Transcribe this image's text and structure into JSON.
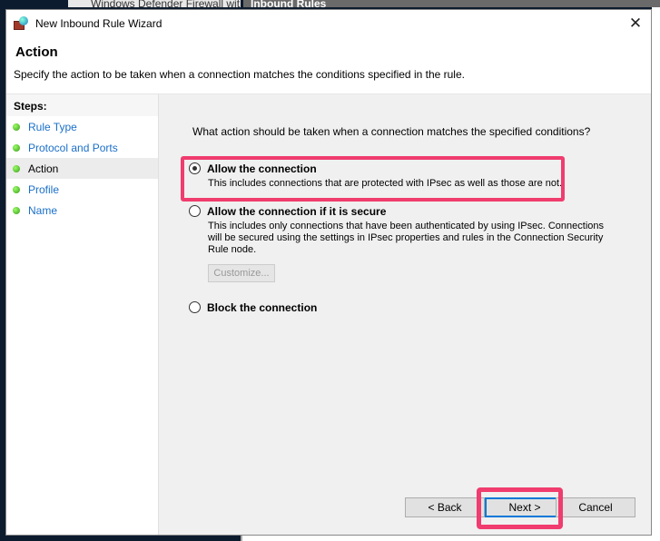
{
  "background": {
    "tab1": "Windows Defender Firewall wit",
    "tab2": "Inbound Rules"
  },
  "window": {
    "title": "New Inbound Rule Wizard",
    "close_icon": "close-icon"
  },
  "header": {
    "title": "Action",
    "subtitle": "Specify the action to be taken when a connection matches the conditions specified in the rule."
  },
  "steps": {
    "heading": "Steps:",
    "items": [
      {
        "label": "Rule Type"
      },
      {
        "label": "Protocol and Ports"
      },
      {
        "label": "Action",
        "current": true
      },
      {
        "label": "Profile"
      },
      {
        "label": "Name"
      }
    ]
  },
  "main": {
    "question": "What action should be taken when a connection matches the specified conditions?",
    "options": [
      {
        "label": "Allow the connection",
        "desc": "This includes connections that are protected with IPsec as well as those are not.",
        "selected": true
      },
      {
        "label": "Allow the connection if it is secure",
        "desc": "This includes only connections that have been authenticated by using IPsec.  Connections will be secured using the settings in IPsec properties and rules in the Connection Security Rule node.",
        "selected": false
      },
      {
        "label": "Block the connection",
        "selected": false
      }
    ],
    "customize_label": "Customize..."
  },
  "buttons": {
    "back": "< Back",
    "next": "Next >",
    "cancel": "Cancel"
  },
  "colors": {
    "highlight": "#f03c6e",
    "link": "#1a6fc9",
    "focus": "#0078d7"
  }
}
